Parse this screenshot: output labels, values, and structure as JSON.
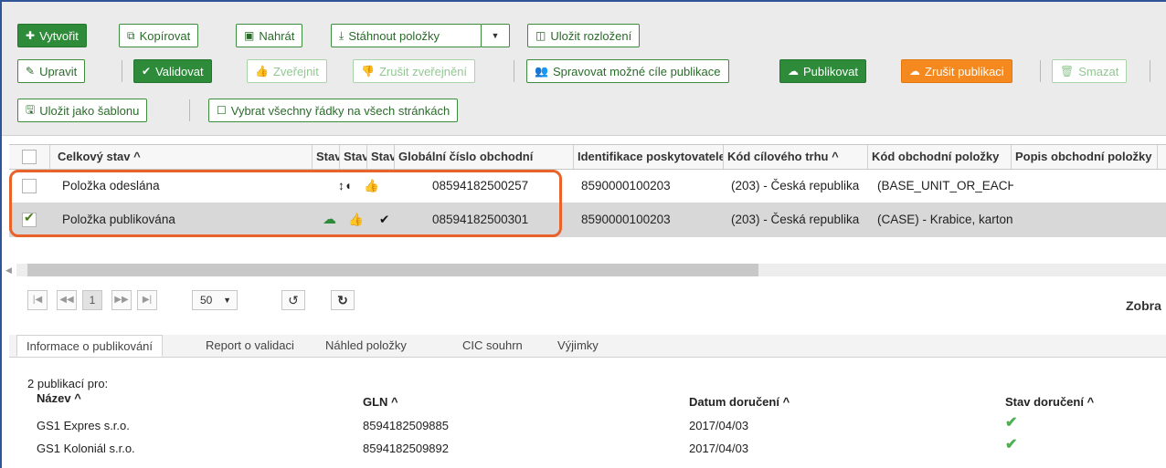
{
  "toolbar": {
    "create": "Vytvořit",
    "copy": "Kopírovat",
    "upload": "Nahrát",
    "download": "Stáhnout položky",
    "save_layout": "Uložit rozložení",
    "edit": "Upravit",
    "validate": "Validovat",
    "publish_disabled": "Zveřejnit",
    "unpublish_disabled": "Zrušit zveřejnění",
    "manage_targets": "Spravovat možné cíle publikace",
    "publish": "Publikovat",
    "cancel_publication": "Zrušit publikaci",
    "delete": "Smazat",
    "save_template": "Uložit jako šablonu",
    "select_all": "Vybrat všechny řádky na všech stránkách"
  },
  "grid": {
    "columns": [
      "Celkový stav ^",
      "Stav",
      "Stav",
      "Stav",
      "Globální číslo obchodní",
      "Identifikace poskytovatele",
      "Kód cílového trhu ^",
      "Kód obchodní položky",
      "Popis obchodní položky"
    ],
    "rows": [
      {
        "status": "Položka odeslána",
        "gtin": "08594182500257",
        "provider": "8590000100203",
        "market": "(203) - Česká republika",
        "code": "(BASE_UNIT_OR_EACH)",
        "desc": ""
      },
      {
        "status": "Položka publikována",
        "gtin": "08594182500301",
        "provider": "8590000100203",
        "market": "(203) - Česká republika",
        "code": "(CASE) - Krabice, karton",
        "desc": ""
      }
    ]
  },
  "pager": {
    "page": "1",
    "page_size": "50",
    "display_text": "Zobra"
  },
  "tabs": [
    "Informace o publikování",
    "Report o validaci",
    "Náhled položky",
    "CIC souhrn",
    "Výjimky"
  ],
  "publication": {
    "count_text": "2 publikací pro:",
    "headers": {
      "name": "Název ^",
      "gln": "GLN ^",
      "date": "Datum doručení ^",
      "state": "Stav doručení ^"
    },
    "rows": [
      {
        "name": "GS1 Expres s.r.o.",
        "gln": "8594182509885",
        "date": "2017/04/03"
      },
      {
        "name": "GS1 Koloniál s.r.o.",
        "gln": "8594182509892",
        "date": "2017/04/03"
      }
    ]
  },
  "colors": {
    "green": "#2e8b3a",
    "orange": "#f5891f",
    "highlight": "#e8622a"
  }
}
